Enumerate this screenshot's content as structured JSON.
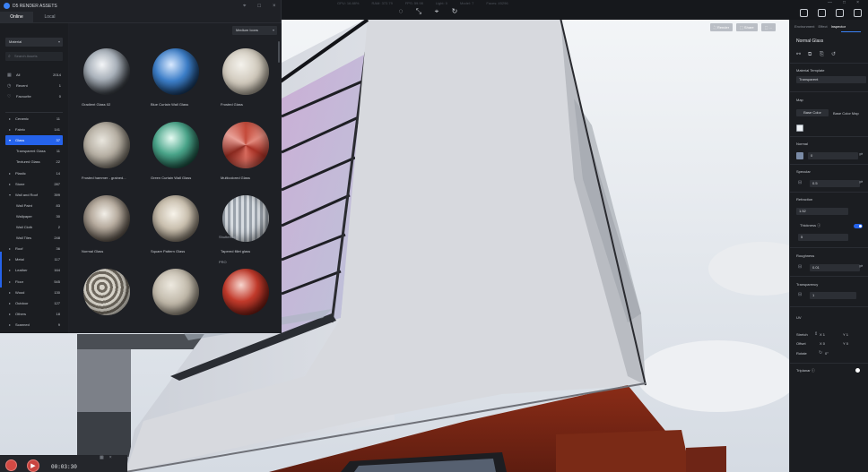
{
  "topbar": {
    "stats": [
      "GPU: 16.88%",
      "RAM: 372.79",
      "FPS: 59.98",
      "Light: 0",
      "Model: 7",
      "Faces: 45296"
    ],
    "window_controls": [
      "—",
      "□",
      "×"
    ]
  },
  "viewport": {
    "buttons": [
      "⛶ Render",
      "⬚ Share",
      "⬚ ..."
    ]
  },
  "assets": {
    "title": "D5 RENDER ASSETS",
    "tabs": [
      "Online",
      "Local"
    ],
    "category_select": "Material",
    "search_placeholder": "Search Assets",
    "size_select": "Medium Icons",
    "quick": [
      {
        "icon": "grid-icon",
        "label": "All",
        "count": "2014"
      },
      {
        "icon": "clock-icon",
        "label": "Recent",
        "count": "1"
      },
      {
        "icon": "heart-icon",
        "label": "Favourite",
        "count": "0"
      }
    ],
    "categories": [
      {
        "label": "Ceramic",
        "count": "11",
        "type": "cat"
      },
      {
        "label": "Fabric",
        "count": "141",
        "type": "cat"
      },
      {
        "label": "Glass",
        "count": "37",
        "type": "sel"
      },
      {
        "label": "Transparent Glass",
        "count": "11",
        "type": "sub"
      },
      {
        "label": "Textured Glass",
        "count": "22",
        "type": "sub"
      },
      {
        "label": "Plastic",
        "count": "14",
        "type": "cat"
      },
      {
        "label": "Stone",
        "count": "287",
        "type": "cat"
      },
      {
        "label": "Wall and Roof",
        "count": "399",
        "type": "open"
      },
      {
        "label": "Wall Paint",
        "count": "83",
        "type": "sub"
      },
      {
        "label": "Wallpaper",
        "count": "30",
        "type": "sub"
      },
      {
        "label": "Wall Cloth",
        "count": "2",
        "type": "sub"
      },
      {
        "label": "Wall Tiles",
        "count": "248",
        "type": "sub"
      },
      {
        "label": "Roof",
        "count": "36",
        "type": "cat"
      },
      {
        "label": "Metal",
        "count": "117",
        "type": "cat"
      },
      {
        "label": "Leather",
        "count": "164",
        "type": "cat"
      },
      {
        "label": "Floor",
        "count": "545",
        "type": "cat"
      },
      {
        "label": "Wood",
        "count": "130",
        "type": "cat"
      },
      {
        "label": "Outdoor",
        "count": "127",
        "type": "cat"
      },
      {
        "label": "Others",
        "count": "18",
        "type": "cat"
      },
      {
        "label": "Scanned",
        "count": "9",
        "type": "cat"
      }
    ],
    "tiles": [
      {
        "label": "Gradient Glass 02",
        "style": "clear"
      },
      {
        "label": "Blue Curtain Wall Glass",
        "style": "blue"
      },
      {
        "label": "Frosted Glass",
        "style": "frost"
      },
      {
        "label": "Frosted hammer - grained...",
        "style": "hammer"
      },
      {
        "label": "Green Curtain Wall Glass",
        "style": "green"
      },
      {
        "label": "Multicolored Glass",
        "style": "multi"
      },
      {
        "label": "Normal Glass",
        "style": "normal"
      },
      {
        "label": "Square Pattern Glass",
        "style": "square"
      },
      {
        "label": "Tapered fillet glass",
        "style": "fillet",
        "watermark": "Shutterstock",
        "pro": "PRO"
      },
      {
        "label": "",
        "style": "wavy"
      },
      {
        "label": "",
        "style": "frost2"
      },
      {
        "label": "",
        "style": "red"
      }
    ]
  },
  "inspector": {
    "tabs": [
      "Environment",
      "Effect",
      "Inspector"
    ],
    "material_name": "Normal Glass",
    "template_label": "Material Template",
    "template_value": "Transparent",
    "map_section": "Map",
    "map_tabs": [
      "Base Color",
      "Base Color Map"
    ],
    "normal_label": "Normal",
    "normal_value": "0",
    "specular_label": "Specular",
    "specular_value": "0.5",
    "refraction_label": "Refraction",
    "refraction_value": "1.52",
    "thickness_label": "Thickness",
    "thickness_value": "5",
    "roughness_label": "Roughness",
    "roughness_value": "0.01",
    "transparency_label": "Transparency",
    "transparency_value": "1",
    "uv_section": "UV",
    "stretch_label": "Stretch",
    "stretch_x": "X 1",
    "stretch_y": "Y 1",
    "offset_label": "Offset",
    "offset_x": "X 0",
    "offset_y": "Y 0",
    "rotate_label": "Rotate",
    "rotate_value": "0°",
    "triplanar_label": "Triplanar",
    "colors": {
      "base": "#eef2f6",
      "normal": "#7a8ba6",
      "accent": "#2563eb"
    }
  },
  "playback": {
    "time": "00:03:30"
  }
}
